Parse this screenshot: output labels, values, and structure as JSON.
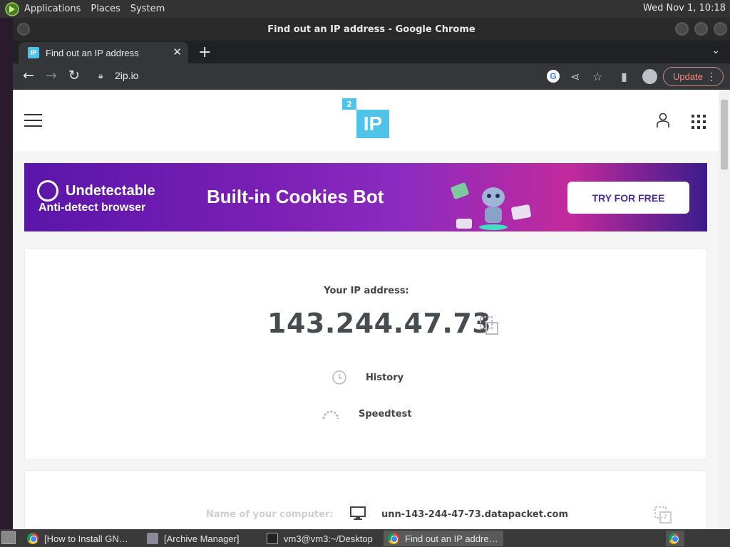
{
  "top_panel": {
    "menus": [
      "Applications",
      "Places",
      "System"
    ],
    "clock": "Wed Nov 1, 10:18"
  },
  "window": {
    "title": "Find out an IP address - Google Chrome"
  },
  "tabs": [
    {
      "label": "Find out an IP address",
      "favicon": "IP"
    }
  ],
  "toolbar": {
    "url": "2ip.io",
    "update_label": "Update"
  },
  "site": {
    "logo_small": "2",
    "logo_big": "IP",
    "banner": {
      "brand_line1": "Undetectable",
      "brand_line2": "Anti-detect browser",
      "headline": "Built-in Cookies Bot",
      "cta": "TRY FOR FREE"
    },
    "ip_card": {
      "label": "Your IP address:",
      "ip": "143.244.47.73",
      "history": "History",
      "speedtest": "Speedtest"
    },
    "info_card": {
      "label": "Name of your computer:",
      "value": "unn-143-244-47-73.datapacket.com"
    }
  },
  "taskbar": {
    "items": [
      {
        "label": "[How to Install GN…",
        "icon": "chrome-icon"
      },
      {
        "label": "[Archive Manager]",
        "icon": "archive-icon"
      },
      {
        "label": "vm3@vm3:~/Desktop",
        "icon": "terminal-icon"
      },
      {
        "label": "Find out an IP addre…",
        "icon": "chrome-icon"
      }
    ]
  },
  "colors": {
    "accent": "#4fc3e8",
    "banner_purple": "#7a1fb5",
    "update_text": "#f28b82"
  }
}
